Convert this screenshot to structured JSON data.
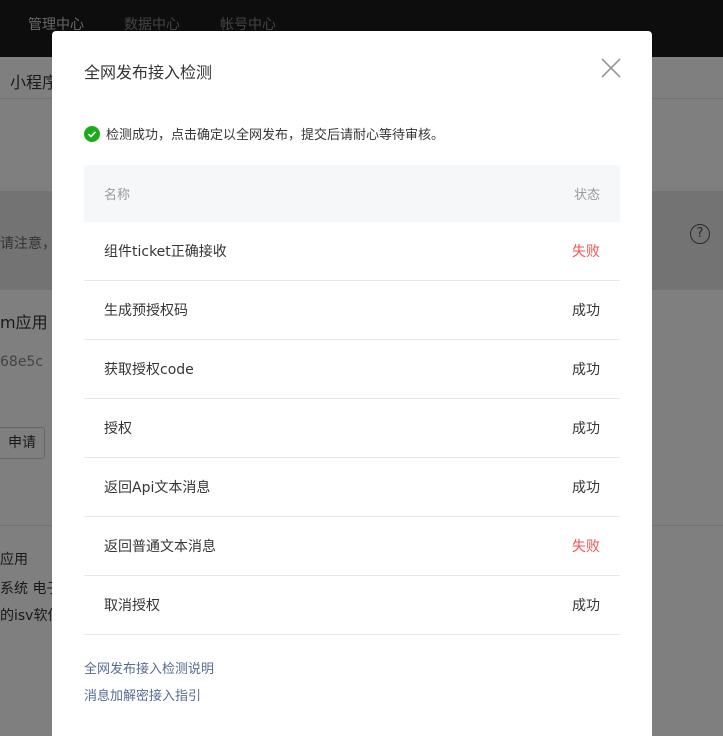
{
  "topnav": [
    "管理中心",
    "数据中心",
    "帐号中心"
  ],
  "background": {
    "section_title": "小程序",
    "notice": "请注意，",
    "app_name": "m应用",
    "app_id": "68e5c",
    "apply_button": "申请",
    "desc1": "应用",
    "desc2": "系统 电子",
    "desc3": "的isv软件"
  },
  "modal": {
    "title": "全网发布接入检测",
    "message": "检测成功，点击确定以全网发布，提交后请耐心等待审核。",
    "columns": [
      "名称",
      "状态"
    ],
    "rows": [
      {
        "name": "组件ticket正确接收",
        "status": "失败",
        "ok": false
      },
      {
        "name": "生成预授权码",
        "status": "成功",
        "ok": true
      },
      {
        "name": "获取授权code",
        "status": "成功",
        "ok": true
      },
      {
        "name": "授权",
        "status": "成功",
        "ok": true
      },
      {
        "name": "返回Api文本消息",
        "status": "成功",
        "ok": true
      },
      {
        "name": "返回普通文本消息",
        "status": "失败",
        "ok": false
      },
      {
        "name": "取消授权",
        "status": "成功",
        "ok": true
      }
    ],
    "links": [
      "全网发布接入检测说明",
      "消息加解密接入指引"
    ]
  },
  "colors": {
    "success": "#1aad19",
    "fail": "#fa5151",
    "link": "#576b95"
  }
}
